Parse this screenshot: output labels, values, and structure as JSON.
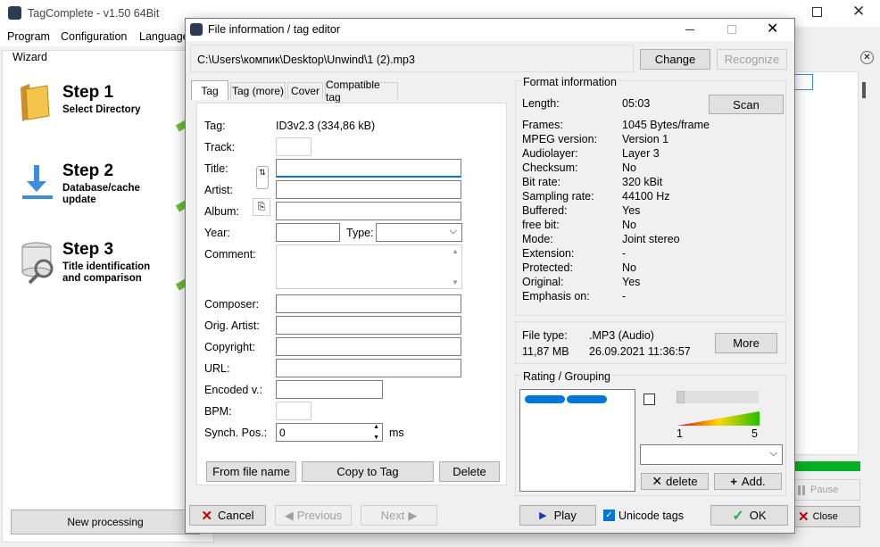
{
  "main": {
    "title": "TagComplete - v1.50 64Bit",
    "menu": [
      "Program",
      "Configuration",
      "Language"
    ],
    "wizard_label": "Wizard",
    "steps": [
      {
        "title": "Step 1",
        "subtitle": "Select Directory",
        "icon": "folder-icon"
      },
      {
        "title": "Step 2",
        "subtitle": "Database/cache update",
        "icon": "download-arrow-icon"
      },
      {
        "title": "Step 3",
        "subtitle": "Title identification and comparison",
        "icon": "database-search-icon"
      }
    ],
    "new_processing": "New processing",
    "pause": "Pause",
    "close": "Close"
  },
  "dialog": {
    "title": "File information / tag editor",
    "path": "C:\\Users\\компик\\Desktop\\Unwind\\1 (2).mp3",
    "change": "Change",
    "recognize": "Recognize",
    "tabs": [
      "Tag",
      "Tag (more)",
      "Cover",
      "Compatible tag"
    ],
    "tag": {
      "labels": {
        "tag": "Tag:",
        "track": "Track:",
        "title": "Title:",
        "artist": "Artist:",
        "album": "Album:",
        "year": "Year:",
        "type": "Type:",
        "comment": "Comment:",
        "composer": "Composer:",
        "orig_artist": "Orig. Artist:",
        "copyright": "Copyright:",
        "url": "URL:",
        "encoded": "Encoded v.:",
        "bpm": "BPM:",
        "synch": "Synch. Pos.:"
      },
      "tag_value": "ID3v2.3 (334,86 kB)",
      "synch_value": "0",
      "synch_unit": "ms",
      "from_file_name": "From file name",
      "copy_to_tag": "Copy to Tag",
      "delete": "Delete"
    },
    "format": {
      "heading": "Format information",
      "scan": "Scan",
      "rows": [
        {
          "label": "Length:",
          "value": "05:03"
        },
        {
          "label": "Frames:",
          "value": "1045 Bytes/frame"
        },
        {
          "label": "MPEG version:",
          "value": "Version 1"
        },
        {
          "label": "Audiolayer:",
          "value": "Layer 3"
        },
        {
          "label": "Checksum:",
          "value": "No"
        },
        {
          "label": "Bit rate:",
          "value": "320 kBit"
        },
        {
          "label": "Sampling rate:",
          "value": "44100 Hz"
        },
        {
          "label": "Buffered:",
          "value": "Yes"
        },
        {
          "label": "free bit:",
          "value": "No"
        },
        {
          "label": "Mode:",
          "value": "Joint stereo"
        },
        {
          "label": "Extension:",
          "value": "-"
        },
        {
          "label": "Protected:",
          "value": "No"
        },
        {
          "label": "Original:",
          "value": "Yes"
        },
        {
          "label": "Emphasis on:",
          "value": "-"
        }
      ]
    },
    "file": {
      "type_label": "File type:",
      "type_value": ".MP3 (Audio)",
      "size": "11,87 MB",
      "date": "26.09.2021 11:36:57",
      "more": "More"
    },
    "rating": {
      "heading": "Rating / Grouping",
      "scale_min": "1",
      "scale_max": "5",
      "delete": "delete",
      "add": "Add."
    },
    "footer": {
      "cancel": "Cancel",
      "previous": "Previous",
      "next": "Next",
      "play": "Play",
      "unicode_tags": "Unicode tags",
      "ok": "OK"
    }
  },
  "colors": {
    "accent": "#0078d7",
    "green": "#22b14c",
    "red": "#c00000"
  }
}
